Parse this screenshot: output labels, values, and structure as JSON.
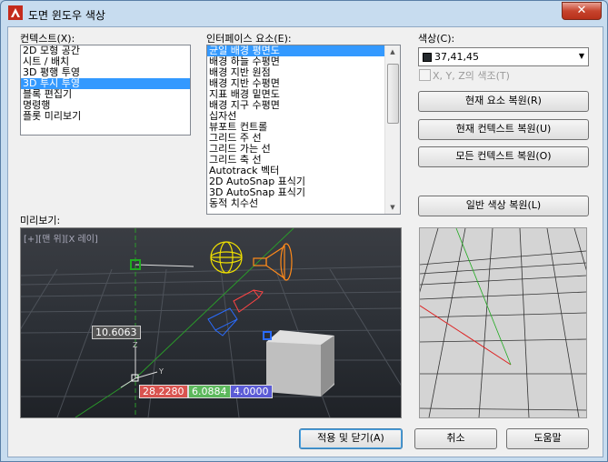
{
  "window": {
    "title": "도면 윈도우 색상",
    "close_label": "✕"
  },
  "context": {
    "label": "컨텍스트(X):",
    "items": [
      "2D 모형 공간",
      "시트 / 배치",
      "3D 평행 투영",
      "3D 투시 투영",
      "블록 편집기",
      "명령행",
      "플롯 미리보기"
    ],
    "selected_index": 3
  },
  "interface": {
    "label": "인터페이스 요소(E):",
    "items": [
      "균일 배경 평면도",
      "배경 하늘 수평면",
      "배경 지반 원점",
      "배경 지반 수평면",
      "지표 배경 밑면도",
      "배경 지구 수평면",
      "십자선",
      "뷰포트 컨트롤",
      "그리드 주 선",
      "그리드 가는 선",
      "그리드 축 선",
      "Autotrack 벡터",
      "2D AutoSnap 표식기",
      "3D AutoSnap 표식기",
      "동적 치수선"
    ],
    "selected_index": 0
  },
  "color": {
    "label": "색상(C):",
    "value": "37,41,45",
    "swatch_hex": "#252a2e",
    "xyz_tint_label": "X, Y, Z의 색조(T)"
  },
  "buttons": {
    "restore_element": "현재 요소 복원(R)",
    "restore_context": "현재 컨텍스트 복원(U)",
    "restore_all": "모든 컨텍스트 복원(O)",
    "restore_classic": "일반 색상 복원(L)",
    "apply_close": "적용 및 닫기(A)",
    "cancel": "취소",
    "help": "도움말"
  },
  "preview": {
    "label": "미리보기:",
    "viewport_label": "[+][맨 위][X 레이]",
    "dim_value": "10.6063",
    "coord_x": "28.2280",
    "coord_y": "6.0884",
    "coord_z": "4.0000",
    "coord_x_color": "#d9534f",
    "coord_y_color": "#5cb85c",
    "coord_z_color": "#5b5bd6"
  }
}
